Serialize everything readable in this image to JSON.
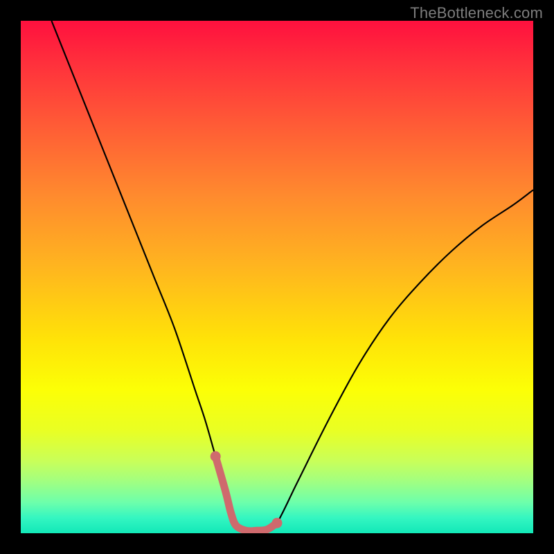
{
  "watermark": "TheBottleneck.com",
  "chart_data": {
    "type": "line",
    "title": "",
    "xlabel": "",
    "ylabel": "",
    "xlim": [
      0,
      100
    ],
    "ylim": [
      0,
      100
    ],
    "grid": false,
    "series": [
      {
        "name": "bottleneck-curve",
        "color": "#000000",
        "x": [
          6,
          10,
          14,
          18,
          22,
          26,
          30,
          34,
          36,
          38,
          40,
          41,
          42,
          44,
          46,
          48,
          50,
          54,
          60,
          66,
          72,
          78,
          84,
          90,
          96,
          100
        ],
        "y": [
          100,
          90,
          80,
          70,
          60,
          50,
          40,
          28,
          22,
          15,
          8,
          4,
          1.5,
          0.5,
          0.5,
          0.7,
          2,
          10,
          22,
          33,
          42,
          49,
          55,
          60,
          64,
          67
        ]
      },
      {
        "name": "optimal-zone",
        "color": "#cf6a6d",
        "x": [
          38,
          40,
          41,
          42,
          44,
          46,
          48,
          50
        ],
        "y": [
          15,
          8,
          4,
          1.5,
          0.5,
          0.5,
          0.7,
          2
        ]
      }
    ],
    "gradient_stops": [
      {
        "pos": 0,
        "color": "#ff103e"
      },
      {
        "pos": 8,
        "color": "#ff2f3c"
      },
      {
        "pos": 20,
        "color": "#ff5a36"
      },
      {
        "pos": 34,
        "color": "#ff8a2e"
      },
      {
        "pos": 48,
        "color": "#ffb51f"
      },
      {
        "pos": 62,
        "color": "#ffe208"
      },
      {
        "pos": 72,
        "color": "#fcff06"
      },
      {
        "pos": 80,
        "color": "#e9ff24"
      },
      {
        "pos": 86,
        "color": "#c8ff5a"
      },
      {
        "pos": 90,
        "color": "#a0ff82"
      },
      {
        "pos": 94,
        "color": "#6dffab"
      },
      {
        "pos": 97,
        "color": "#34f6c1"
      },
      {
        "pos": 100,
        "color": "#12e8b8"
      }
    ]
  }
}
